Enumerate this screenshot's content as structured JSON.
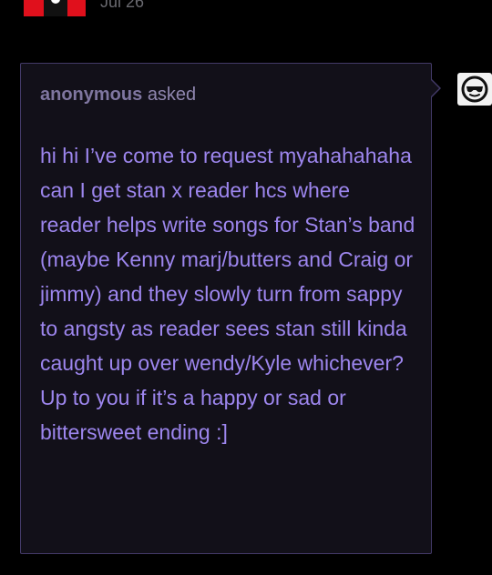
{
  "post": {
    "date": "Jul 26",
    "avatar_icon": "blog-avatar-icon"
  },
  "ask": {
    "asker": "anonymous",
    "verb": "asked",
    "body": "hi hi I’ve come to request myahahahaha can I get stan x reader hcs where reader helps write songs for Stan’s band (maybe Kenny marj/butters and Craig or jimmy) and they slowly turn from sappy to angsty as reader sees stan still kinda caught up over wendy/Kyle whichever? Up to you if it’s a happy or sad or bittersweet ending :]",
    "asker_avatar_icon": "anonymous-sunglasses-icon"
  },
  "colors": {
    "background": "#000000",
    "card_background": "#121019",
    "card_border": "#433a68",
    "body_text": "#9d86ee",
    "header_text": "#8f86ae"
  }
}
